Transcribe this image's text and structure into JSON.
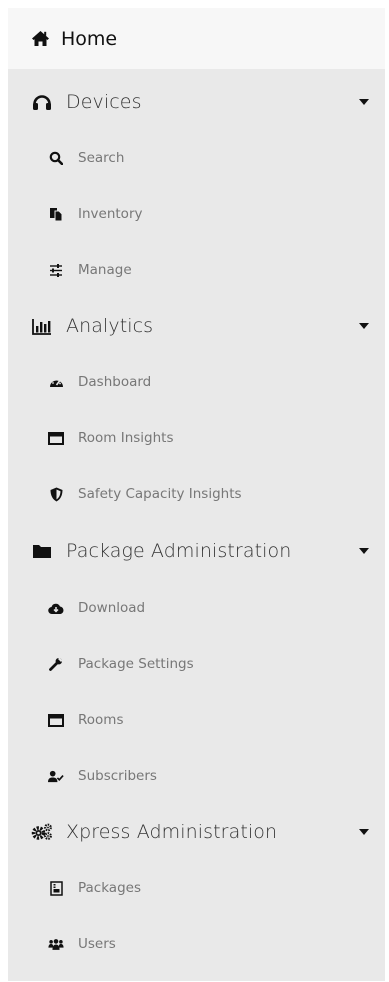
{
  "nav": {
    "home": {
      "label": "Home",
      "icon": "home-icon"
    },
    "devices": {
      "label": "Devices",
      "icon": "headset-icon",
      "items": [
        {
          "label": "Search",
          "icon": "search-icon"
        },
        {
          "label": "Inventory",
          "icon": "copy-icon"
        },
        {
          "label": "Manage",
          "icon": "sliders-icon"
        }
      ]
    },
    "analytics": {
      "label": "Analytics",
      "icon": "bar-chart-icon",
      "items": [
        {
          "label": "Dashboard",
          "icon": "tachometer-icon"
        },
        {
          "label": "Room Insights",
          "icon": "window-icon"
        },
        {
          "label": "Safety Capacity Insights",
          "icon": "shield-icon"
        }
      ]
    },
    "package_admin": {
      "label": "Package Administration",
      "icon": "folder-icon",
      "items": [
        {
          "label": "Download",
          "icon": "cloud-download-icon"
        },
        {
          "label": "Package Settings",
          "icon": "wrench-icon"
        },
        {
          "label": "Rooms",
          "icon": "window-icon"
        },
        {
          "label": "Subscribers",
          "icon": "user-check-icon"
        }
      ]
    },
    "xpress_admin": {
      "label": "Xpress Administration",
      "icon": "cogs-icon",
      "items": [
        {
          "label": "Packages",
          "icon": "package-file-icon"
        },
        {
          "label": "Users",
          "icon": "users-icon"
        }
      ]
    }
  }
}
